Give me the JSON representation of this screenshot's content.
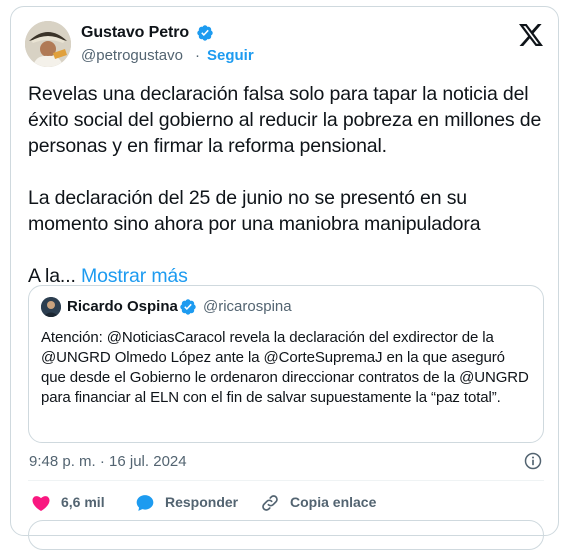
{
  "author": {
    "name": "Gustavo Petro",
    "handle": "@petrogustavo",
    "separator": "·",
    "follow_label": "Seguir"
  },
  "tweet": {
    "paragraphs": [
      "Revelas una declaración falsa solo para tapar la noticia del éxito social del gobierno al reducir la pobreza en millones de personas y en firmar la reforma pensional.",
      "La declaración del 25 de junio no se presentó en su momento sino ahora por una maniobra manipuladora"
    ],
    "truncated_text": "A la...",
    "show_more_label": "Mostrar más"
  },
  "quote": {
    "name": "Ricardo Ospina",
    "handle": "@ricarospina",
    "text": "Atención: @NoticiasCaracol revela la declaración del exdirector de la @UNGRD Olmedo López ante la @CorteSupremaJ en la que aseguró que desde el Gobierno le ordenaron direccionar contratos de la @UNGRD para financiar al ELN con el fin de salvar supuestamente la “paz total”."
  },
  "timestamp": "9:48 p. m. · 16 jul. 2024",
  "actions": {
    "likes": "6,6 mil",
    "reply_label": "Responder",
    "copy_label": "Copia enlace"
  },
  "colors": {
    "accent": "#1d9bf0",
    "like": "#f91880",
    "text": "#0f1419",
    "muted": "#536471",
    "border": "#cfd9de"
  },
  "icons": [
    "verified-badge-icon",
    "x-logo-icon",
    "info-icon",
    "heart-icon",
    "reply-bubble-icon",
    "link-icon"
  ]
}
